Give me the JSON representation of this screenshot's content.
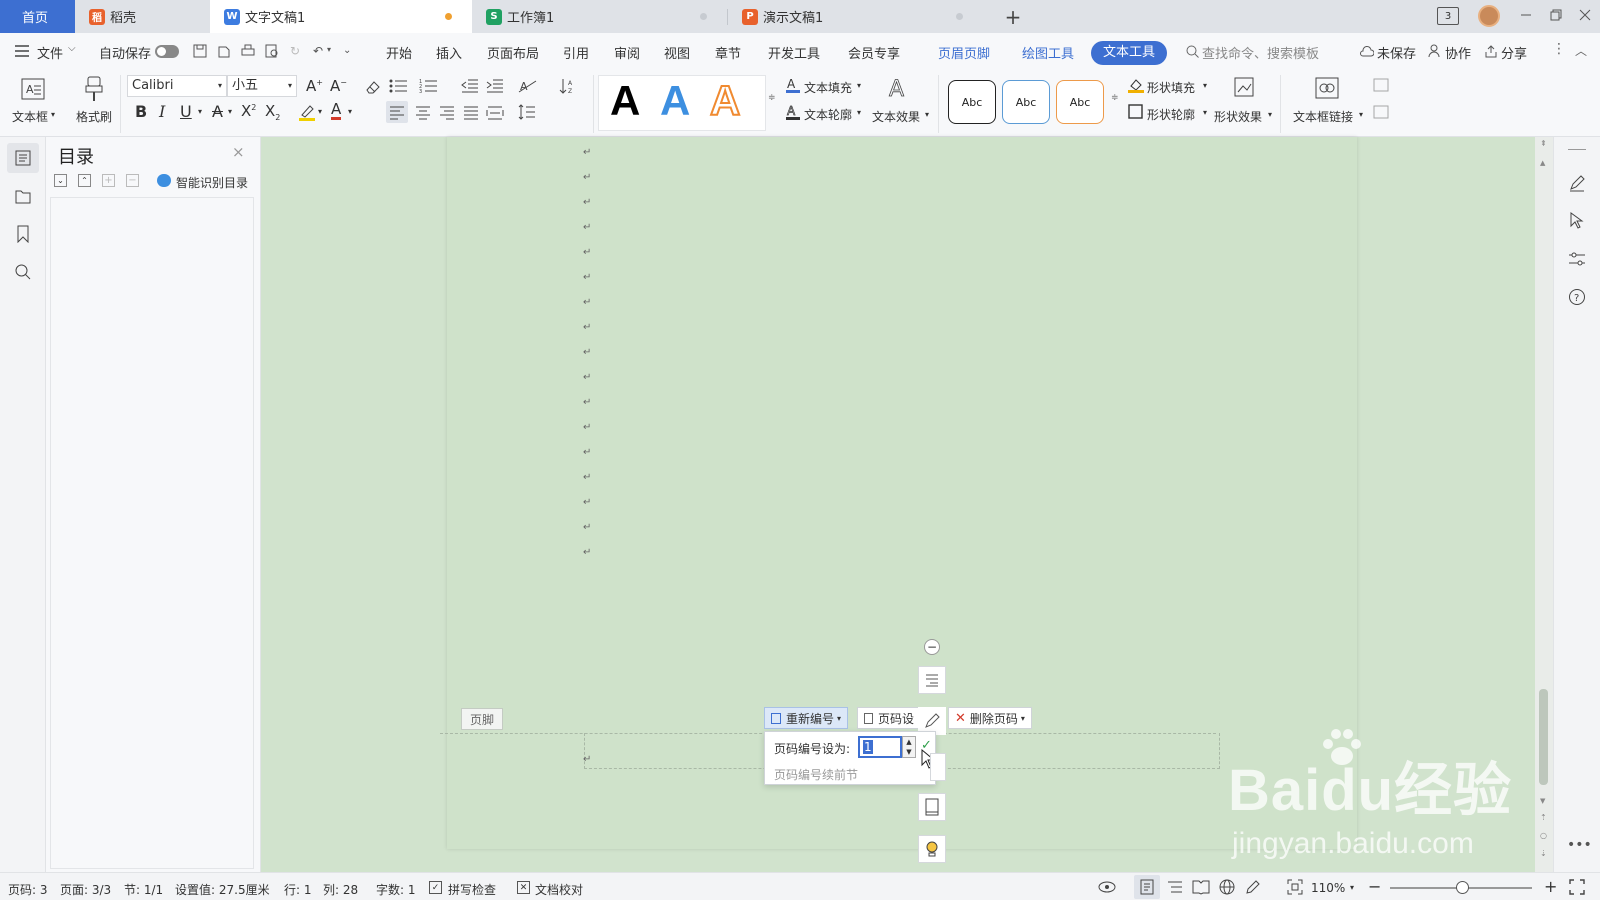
{
  "tabs": {
    "home": "首页",
    "daoke": "稻壳",
    "doc": "文字文稿1",
    "sheet": "工作簿1",
    "ppt": "演示文稿1",
    "window_count": "3"
  },
  "menu": {
    "file": "文件",
    "autosave": "自动保存",
    "items": [
      "开始",
      "插入",
      "页面布局",
      "引用",
      "审阅",
      "视图",
      "章节",
      "开发工具",
      "会员专享"
    ],
    "ctx_header_footer": "页眉页脚",
    "ctx_drawing": "绘图工具",
    "ctx_text": "文本工具",
    "search_placeholder": "查找命令、搜索模板",
    "unsaved": "未保存",
    "collab": "协作",
    "share": "分享"
  },
  "ribbon": {
    "textbox": "文本框",
    "format_painter": "格式刷",
    "font_name": "Calibri",
    "font_size": "小五",
    "text_fill": "文本填充",
    "text_outline": "文本轮廓",
    "text_effect": "文本效果",
    "style_samples": [
      "Abc",
      "Abc",
      "Abc"
    ],
    "shape_fill": "形状填充",
    "shape_outline": "形状轮廓",
    "shape_effect": "形状效果",
    "textbox_link": "文本框链接",
    "big_letters": [
      "A",
      "A",
      "A"
    ]
  },
  "toc": {
    "title": "目录",
    "smart": "智能识别目录"
  },
  "footer": {
    "label": "页脚",
    "renumber": "重新编号",
    "page_setting": "页码设",
    "delete_page_number": "删除页码",
    "set_to_label": "页码编号设为:",
    "set_to_value": "1",
    "continue_prev": "页码编号续前节"
  },
  "watermark": {
    "brand": "Baidu经验",
    "url": "jingyan.baidu.com"
  },
  "status": {
    "page_num": "页码: 3",
    "pages": "页面: 3/3",
    "section": "节: 1/1",
    "setting": "设置值: 27.5厘米",
    "row": "行: 1",
    "col": "列: 28",
    "words": "字数: 1",
    "spell": "拼写检查",
    "proof": "文档校对",
    "zoom": "110%"
  },
  "colors": {
    "accent": "#3d6fd1",
    "page_bg": "#cfe2ca",
    "workspace_bg": "#d1e3cd",
    "tab_active_bg": "#ffffff",
    "home_tab_bg": "#3d6fd1",
    "wps_red": "#e8612c",
    "sheet_green": "#20a162",
    "ppt_orange": "#e8612c",
    "doc_blue": "#3d7ce0"
  }
}
